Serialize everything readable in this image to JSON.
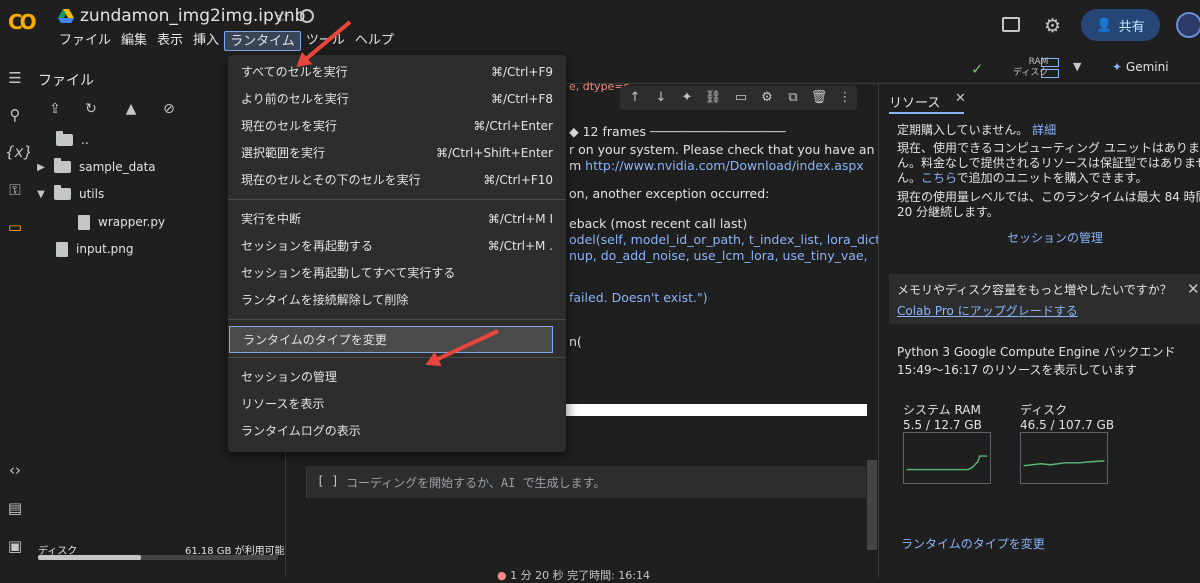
{
  "topbar": {
    "logo": "CO",
    "notebook_title": "zundamon_img2img.ipynb",
    "share_label": "共有",
    "menus": [
      "ファイル",
      "編集",
      "表示",
      "挿入",
      "ランタイム",
      "ツール",
      "ヘルプ"
    ],
    "active_menu": "ランタイム"
  },
  "files": {
    "title": "ファイル",
    "tree": [
      {
        "name": "..",
        "type": "folder"
      },
      {
        "name": "sample_data",
        "type": "folder"
      },
      {
        "name": "utils",
        "type": "folder"
      },
      {
        "name": "wrapper.py",
        "type": "file"
      },
      {
        "name": "input.png",
        "type": "file"
      }
    ],
    "disk_label": "ディスク",
    "disk_free": "61.18 GB が利用可能",
    "disk_used_fraction": 0.43
  },
  "toolbar": {
    "ram_label": "RAM",
    "disk_label": "ディスク",
    "gemini_label": "Gemini"
  },
  "output": {
    "frames": "12 frames",
    "lines": [
      "r on your system. Please check that you have an",
      "m ",
      "on, another exception occurred:",
      "eback (most recent call last)",
      "odel(self, model_id_or_path, t_index_list, lora_dict,",
      "nup, do_add_noise, use_lcm_lora, use_tiny_vae,",
      "failed. Doesn't exist.\")",
      "n("
    ],
    "nvidia_link": "http://www.nvidia.com/Download/index.aspx",
    "partial_top": "e, dtype=s",
    "cell_bracket": "[ ]",
    "cell_placeholder": "コーディングを開始するか、AI で生成します。",
    "status": "1 分 20 秒   完了時間: 16:14"
  },
  "runtime_menu": {
    "items": [
      {
        "label": "すべてのセルを実行",
        "shortcut": "⌘/Ctrl+F9"
      },
      {
        "label": "より前のセルを実行",
        "shortcut": "⌘/Ctrl+F8"
      },
      {
        "label": "現在のセルを実行",
        "shortcut": "⌘/Ctrl+Enter"
      },
      {
        "label": "選択範囲を実行",
        "shortcut": "⌘/Ctrl+Shift+Enter"
      },
      {
        "label": "現在のセルとその下のセルを実行",
        "shortcut": "⌘/Ctrl+F10"
      },
      {
        "label": "実行を中断",
        "shortcut": "⌘/Ctrl+M I"
      },
      {
        "label": "セッションを再起動する",
        "shortcut": "⌘/Ctrl+M ."
      },
      {
        "label": "セッションを再起動してすべて実行する",
        "shortcut": ""
      },
      {
        "label": "ランタイムを接続解除して削除",
        "shortcut": ""
      },
      {
        "label": "ランタイムのタイプを変更",
        "shortcut": ""
      },
      {
        "label": "セッションの管理",
        "shortcut": ""
      },
      {
        "label": "リソースを表示",
        "shortcut": ""
      },
      {
        "label": "ランタイムログの表示",
        "shortcut": ""
      }
    ]
  },
  "resources": {
    "tab_label": "リソース",
    "line1": "定期購入していません。",
    "line1_link": "詳細",
    "p1": [
      "現在、使用できるコンピューティング ユニットはありませ",
      "ん。料金なしで提供されるリソースは保証型ではありませ"
    ],
    "p1_line3_pre": "ん。",
    "p1_line3_link": "こちら",
    "p1_line3_post": "で追加のユニットを購入できます。",
    "p2": [
      "現在の使用量レベルでは、このランタイムは最大 84 時間",
      "20 分継続します。"
    ],
    "manage_link": "セッションの管理",
    "upgrade_q": "メモリやディスク容量をもっと増やしたいですか？",
    "upgrade_link": "Colab Pro にアップグレードする",
    "backend": "Python 3 Google Compute Engine バックエンド",
    "time_range": "15:49〜16:17 のリソースを表示しています",
    "ram_title": "システム RAM",
    "ram_value": "5.5 / 12.7 GB",
    "disk_title": "ディスク",
    "disk_value": "46.5 / 107.7 GB",
    "change_runtime": "ランタイムのタイプを変更"
  },
  "colors": {
    "accent": "#8ab4f8",
    "arrow": "#e8453c",
    "logo": "#f9ab00",
    "chart_line": "#5bb974"
  }
}
